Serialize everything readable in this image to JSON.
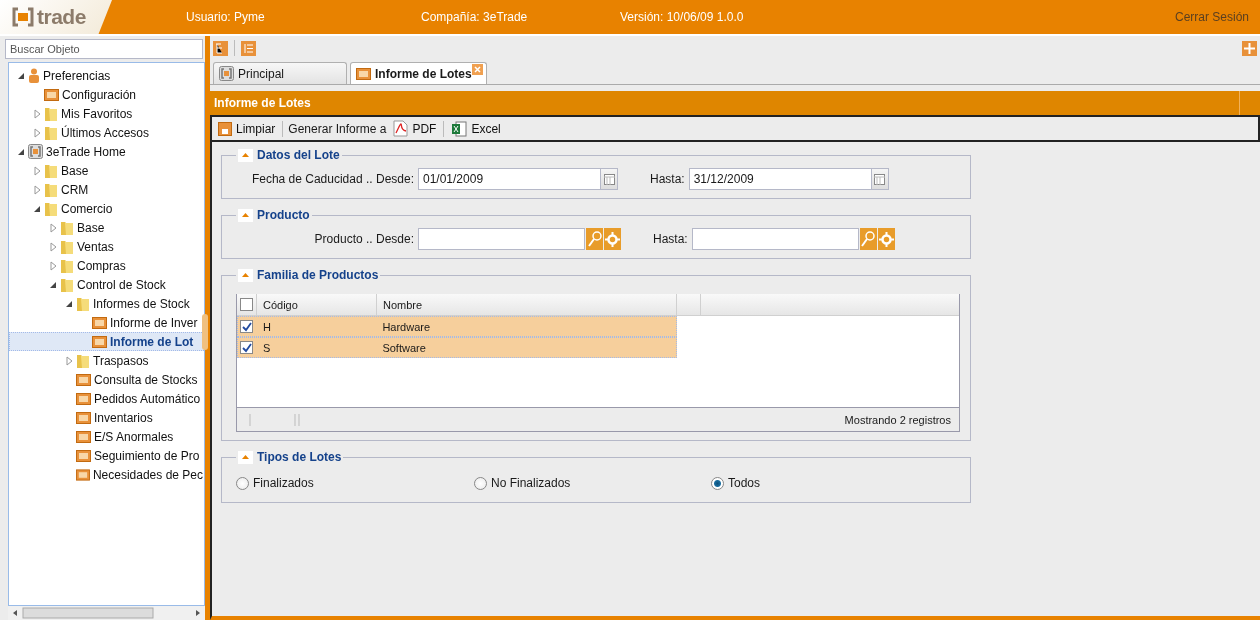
{
  "header": {
    "logo_text": "trade",
    "user": "Usuario: Pyme",
    "company": "Compañía: 3eTrade",
    "version": "Versión: 10/06/09 1.0.0",
    "logout": "Cerrar Sesión"
  },
  "sidebar": {
    "search": {
      "placeholder": "Buscar Objeto"
    },
    "tree": [
      {
        "label": "Preferencias",
        "kind": "person",
        "expanded": true,
        "selected": false,
        "children": [
          {
            "label": "Configuración",
            "kind": "report",
            "selected": false
          },
          {
            "label": "Mis Favoritos",
            "kind": "folder",
            "expanded": false,
            "selected": false
          },
          {
            "label": "Últimos Accesos",
            "kind": "folder",
            "expanded": false,
            "selected": false
          }
        ]
      },
      {
        "label": "3eTrade Home",
        "kind": "home",
        "expanded": true,
        "selected": false,
        "children": [
          {
            "label": "Base",
            "kind": "folder",
            "expanded": false,
            "selected": false
          },
          {
            "label": "CRM",
            "kind": "folder",
            "expanded": false,
            "selected": false
          },
          {
            "label": "Comercio",
            "kind": "folder",
            "expanded": true,
            "selected": false,
            "children": [
              {
                "label": "Base",
                "kind": "folder",
                "expanded": false,
                "selected": false
              },
              {
                "label": "Ventas",
                "kind": "folder",
                "expanded": false,
                "selected": false
              },
              {
                "label": "Compras",
                "kind": "folder",
                "expanded": false,
                "selected": false
              },
              {
                "label": "Control de Stock",
                "kind": "folder",
                "expanded": true,
                "selected": false,
                "children": [
                  {
                    "label": "Informes de Stock",
                    "kind": "folder",
                    "expanded": true,
                    "selected": false,
                    "children": [
                      {
                        "label": "Informe de Inver",
                        "kind": "report",
                        "selected": false
                      },
                      {
                        "label": "Informe de Lot",
                        "kind": "report",
                        "selected": true
                      }
                    ]
                  },
                  {
                    "label": "Traspasos",
                    "kind": "folder",
                    "expanded": false,
                    "selected": false
                  },
                  {
                    "label": "Consulta de Stocks",
                    "kind": "report",
                    "selected": false
                  },
                  {
                    "label": "Pedidos Automático",
                    "kind": "report",
                    "selected": false
                  },
                  {
                    "label": "Inventarios",
                    "kind": "report",
                    "selected": false
                  },
                  {
                    "label": "E/S Anormales",
                    "kind": "report",
                    "selected": false
                  },
                  {
                    "label": "Seguimiento de Pro",
                    "kind": "report",
                    "selected": false
                  },
                  {
                    "label": "Necesidades de Pec",
                    "kind": "report",
                    "selected": false
                  }
                ]
              }
            ]
          }
        ]
      }
    ]
  },
  "tabs": [
    {
      "label": "Principal",
      "kind": "home",
      "selected": false,
      "closable": false
    },
    {
      "label": "Informe de Lotes",
      "kind": "report",
      "selected": true,
      "closable": true
    }
  ],
  "panel": {
    "title": "Informe de Lotes",
    "toolbar": [
      [
        {
          "kind": "clear",
          "label": "Limpiar"
        }
      ],
      [
        {
          "kind": "text",
          "label": "Generar Informe a"
        },
        {
          "kind": "pdf",
          "label": "PDF"
        }
      ],
      [
        {
          "kind": "excel",
          "label": "Excel"
        }
      ]
    ],
    "sections": [
      {
        "kind": "fields",
        "title": "Datos del Lote",
        "fields": [
          {
            "kind": "date",
            "label": "Fecha de Caducidad .. Desde:",
            "value": "01/01/2009"
          },
          {
            "kind": "date",
            "label": "Hasta:",
            "value": "31/12/2009"
          }
        ]
      },
      {
        "kind": "fields",
        "title": "Producto",
        "fields": [
          {
            "kind": "lookup",
            "label": "Producto .. Desde:"
          },
          {
            "kind": "lookup",
            "label": "Hasta:"
          }
        ]
      },
      {
        "kind": "grid",
        "title": "Familia de Productos",
        "all_checked": false,
        "columns": [
          "Código",
          "Nombre"
        ],
        "rows": [
          {
            "checked": true,
            "cells": [
              "H",
              "Hardware"
            ]
          },
          {
            "checked": true,
            "cells": [
              "S",
              "Software"
            ]
          }
        ],
        "footer": "Mostrando 2 registros"
      },
      {
        "kind": "radios",
        "title": "Tipos de Lotes",
        "options": [
          {
            "label": "Finalizados",
            "selected": false
          },
          {
            "label": "No Finalizados",
            "selected": false
          },
          {
            "label": "Todos",
            "selected": true
          }
        ]
      }
    ]
  }
}
